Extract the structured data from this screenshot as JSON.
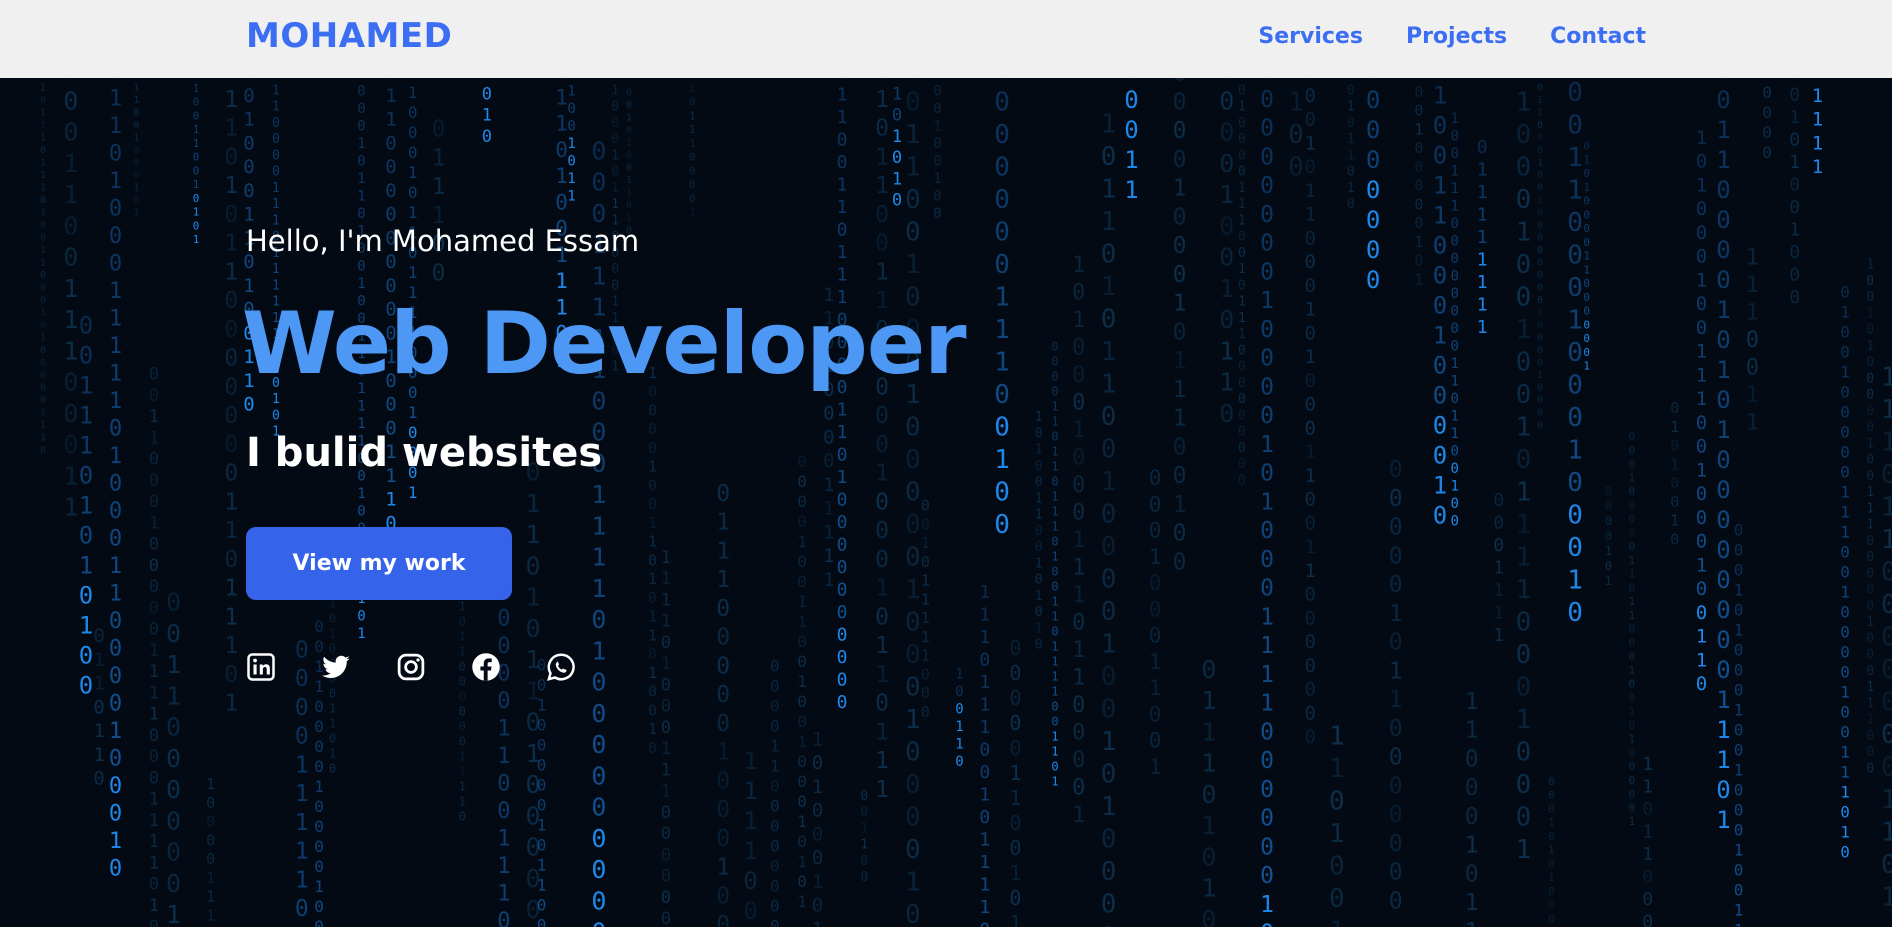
{
  "header": {
    "logo": "MOHAMED",
    "nav": [
      "Services",
      "Projects",
      "Contact"
    ]
  },
  "hero": {
    "greeting": "Hello, I'm Mohamed Essam",
    "role": "Web Developer",
    "tagline": "I bulid websites",
    "cta_label": "View my work",
    "socials": [
      "linkedin-icon",
      "twitter-icon",
      "instagram-icon",
      "facebook-icon",
      "whatsapp-icon"
    ],
    "background": "binary-rain"
  },
  "colors": {
    "accent": "#3b6ef2",
    "role_text": "#4d98f5",
    "button": "#3563ea",
    "header_bg": "#f0f0f0",
    "hero_bg": "#040a14",
    "rain_bright": "#1f8ff5",
    "rain_dim": "#0e3a5c"
  }
}
